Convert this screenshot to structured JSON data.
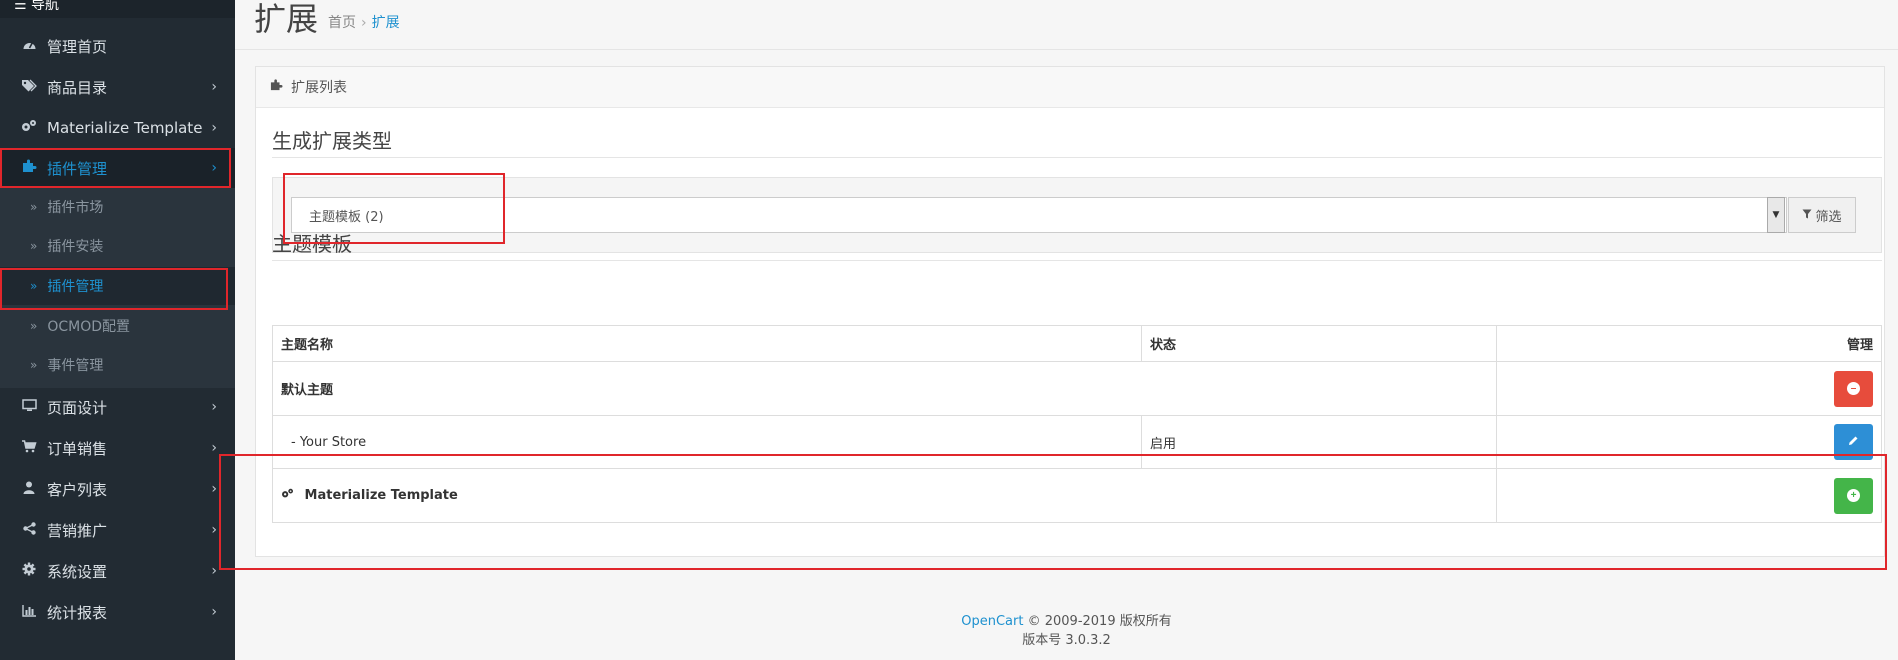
{
  "sidebar": {
    "nav_title": "☰ 导航",
    "items": [
      {
        "label": "管理首页",
        "icon": "dashboard-icon"
      },
      {
        "label": "商品目录",
        "icon": "tags-icon"
      },
      {
        "label": "Materialize Template",
        "icon": "cogs-icon"
      },
      {
        "label": "插件管理",
        "icon": "puzzle-icon"
      },
      {
        "label": "页面设计",
        "icon": "desktop-icon"
      },
      {
        "label": "订单销售",
        "icon": "cart-icon"
      },
      {
        "label": "客户列表",
        "icon": "user-icon"
      },
      {
        "label": "营销推广",
        "icon": "share-icon"
      },
      {
        "label": "系统设置",
        "icon": "gear-icon"
      },
      {
        "label": "统计报表",
        "icon": "bar-chart-icon"
      }
    ],
    "sub_items": [
      {
        "label": "插件市场"
      },
      {
        "label": "插件安装"
      },
      {
        "label": "插件管理"
      },
      {
        "label": "OCMOD配置"
      },
      {
        "label": "事件管理"
      }
    ]
  },
  "header": {
    "title": "扩展",
    "breadcrumb": [
      "首页",
      "扩展"
    ]
  },
  "panel": {
    "heading": "扩展列表",
    "section_type_title": "生成扩展类型",
    "select_value": "主题模板 (2)",
    "filter_label": "筛选",
    "section_theme_title": "主题模板"
  },
  "table": {
    "headers": [
      "主题名称",
      "状态",
      "管理"
    ],
    "rows": [
      {
        "name": "默认主题",
        "status": ""
      },
      {
        "name": "-   Your Store",
        "status": "启用"
      },
      {
        "name": "Materialize Template",
        "status": ""
      }
    ]
  },
  "footer": {
    "brand": "OpenCart",
    "copyright": "© 2009-2019 版权所有",
    "version": "版本号 3.0.3.2"
  },
  "colors": {
    "sidebar_bg": "#222b33",
    "accent": "#1e91cf",
    "danger": "#e74c3c",
    "primary": "#2d8fd6",
    "success": "#44b549",
    "highlight": "#e0262b"
  }
}
